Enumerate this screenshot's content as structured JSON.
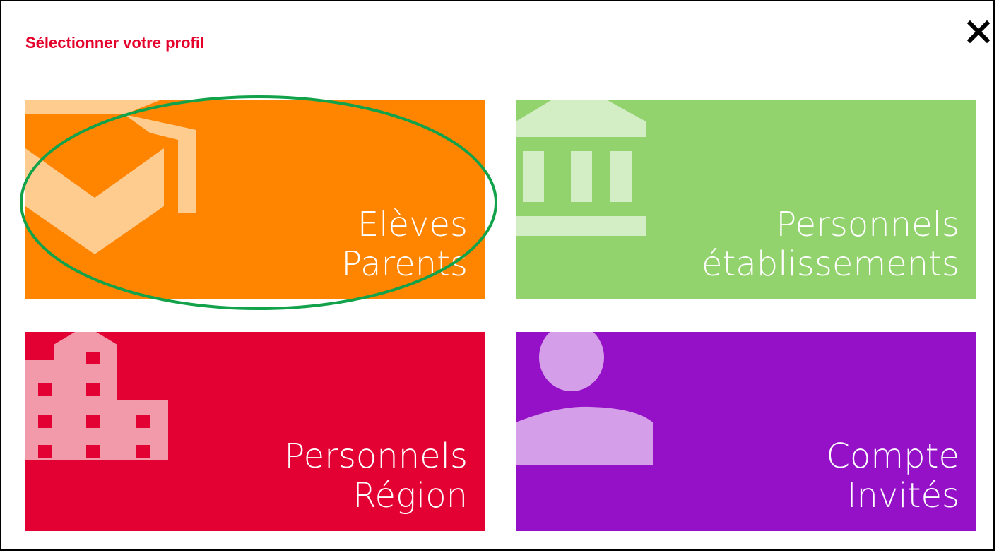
{
  "dialog": {
    "title": "Sélectionner votre profil",
    "close_label": "close"
  },
  "tiles": [
    {
      "id": "eleves-parents",
      "line1": "Elèves",
      "line2": "Parents",
      "color": "#ff8400",
      "icon": "graduation-cap-icon",
      "highlighted": true
    },
    {
      "id": "personnels-etablissements",
      "line1": "Personnels",
      "line2": "établissements",
      "color": "#92d36e",
      "icon": "institution-building-icon"
    },
    {
      "id": "personnels-region",
      "line1": "Personnels",
      "line2": "Région",
      "color": "#e30033",
      "icon": "office-building-icon"
    },
    {
      "id": "compte-invites",
      "line1": "Compte",
      "line2": "Invités",
      "color": "#9511c8",
      "icon": "user-icon"
    }
  ],
  "highlight_color": "#11a24a"
}
